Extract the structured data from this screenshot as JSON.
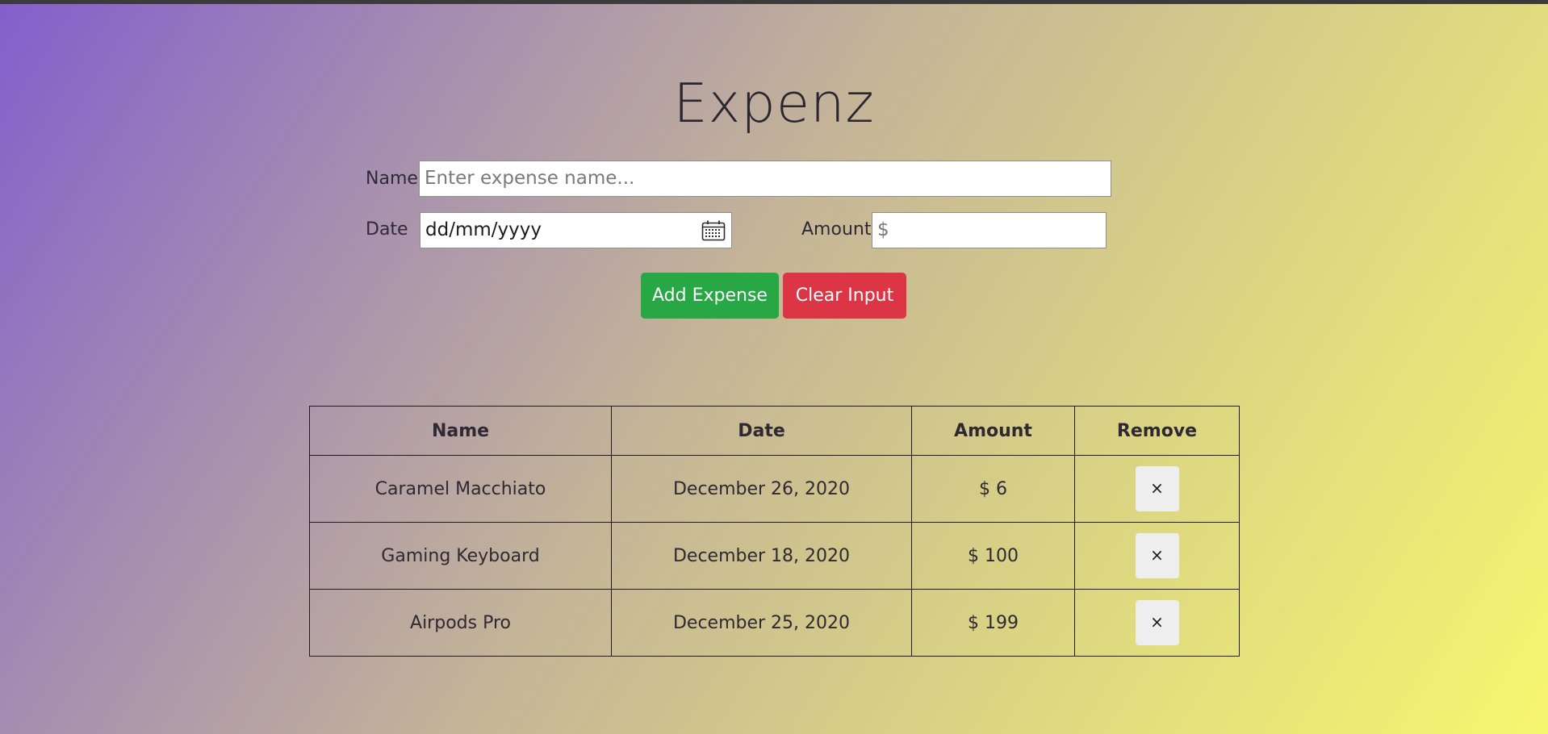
{
  "app": {
    "title": "Expenz"
  },
  "form": {
    "name_label": "Name",
    "name_placeholder": "Enter expense name...",
    "date_label": "Date",
    "date_placeholder": "dd/mm/yyyy",
    "amount_label": "Amount",
    "amount_placeholder": "$",
    "add_button": "Add Expense",
    "clear_button": "Clear Input"
  },
  "table": {
    "headers": [
      "Name",
      "Date",
      "Amount",
      "Remove"
    ],
    "rows": [
      {
        "name": "Caramel Macchiato",
        "date": "December 26, 2020",
        "amount": "$ 6",
        "remove": "×"
      },
      {
        "name": "Gaming Keyboard",
        "date": "December 18, 2020",
        "amount": "$ 100",
        "remove": "×"
      },
      {
        "name": "Airpods Pro",
        "date": "December 25, 2020",
        "amount": "$ 199",
        "remove": "×"
      }
    ]
  },
  "colors": {
    "add_button": "#28a745",
    "clear_button": "#dc3545"
  },
  "icons": {
    "date_picker": "calendar-icon",
    "remove": "close-icon"
  }
}
